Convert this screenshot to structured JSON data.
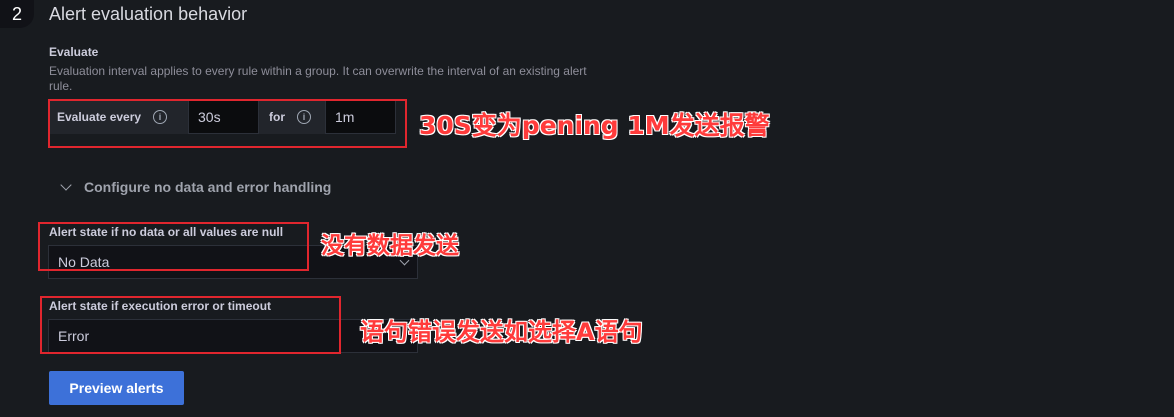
{
  "step": {
    "number": "2",
    "title": "Alert evaluation behavior"
  },
  "evaluate": {
    "label": "Evaluate",
    "description": "Evaluation interval applies to every rule within a group. It can overwrite the interval of an existing alert rule.",
    "every_label": "Evaluate every",
    "every_value": "30s",
    "for_label": "for",
    "for_value": "1m"
  },
  "collapsible": {
    "label": "Configure no data and error handling",
    "icon": "chevron-down-icon"
  },
  "no_data": {
    "label": "Alert state if no data or all values are null",
    "value": "No Data"
  },
  "exec_error": {
    "label": "Alert state if execution error or timeout",
    "value": "Error"
  },
  "preview_button": "Preview alerts",
  "annotations": {
    "evaluate_note": "30S变为pening 1M发送报警",
    "no_data_note": "没有数据发送",
    "error_note": "语句错误发送如选择A语句"
  },
  "colors": {
    "annotation": "#ff3b3b",
    "primary_button": "#3d71d9",
    "background": "#181b1f"
  }
}
